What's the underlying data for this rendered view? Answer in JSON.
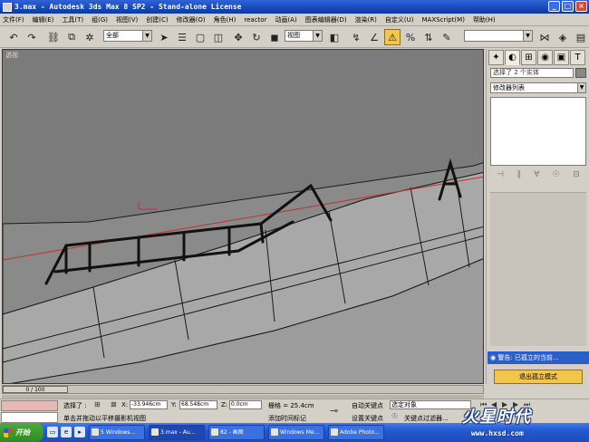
{
  "window": {
    "title": "3.max - Autodesk 3ds Max 8 SP2  - Stand-alone License",
    "minimize": "_",
    "maximize": "□",
    "close": "×"
  },
  "menu": [
    "文件(F)",
    "编辑(E)",
    "工具(T)",
    "组(G)",
    "视图(V)",
    "创建(C)",
    "修改器(O)",
    "角色(H)",
    "reactor",
    "动画(A)",
    "图表编辑器(D)",
    "渲染(R)",
    "自定义(U)",
    "MAXScript(M)",
    "帮助(H)"
  ],
  "toolbar": {
    "selection_filter": "全部",
    "reference_coord": "视图",
    "named_selection": ""
  },
  "viewport": {
    "label": "透视"
  },
  "command_panel": {
    "object_name": "选择了 2 个实体",
    "modifier_list": "修改器列表",
    "warning": "警告: 已孤立的当前...",
    "exit_isolation": "退出孤立模式"
  },
  "timeline": {
    "frame": "0 / 100"
  },
  "status": {
    "selected": "选择了 :",
    "x_label": "X:",
    "x_value": "-33.946cm",
    "y_label": "Y:",
    "y_value": "68.548cm",
    "z_label": "Z:",
    "z_value": "0.0cm",
    "grid": "栅格 = 25.4cm",
    "prompt": "单击并拖动以平移摄影机视图",
    "add_time_tag": "添加时间标记",
    "auto_key": "自动关键点",
    "set_key": "设置关键点",
    "key_filter_select": "选定对象",
    "key_filters": "关键点过滤器..."
  },
  "taskbar": {
    "start": "开始",
    "tasks": [
      "5 Windows...",
      "3.max - Au...",
      "82 - 画图",
      "Windows Me...",
      "Adobe Photo..."
    ]
  },
  "watermark": {
    "text_big": "火星时代",
    "text_small": "www.hxsd.com"
  },
  "colors": {
    "title_bar": "#1748b8",
    "viewport_bg": "#7a7a7a",
    "warning_bar": "#2a5fc8",
    "isolate_button": "#f2c64a"
  }
}
